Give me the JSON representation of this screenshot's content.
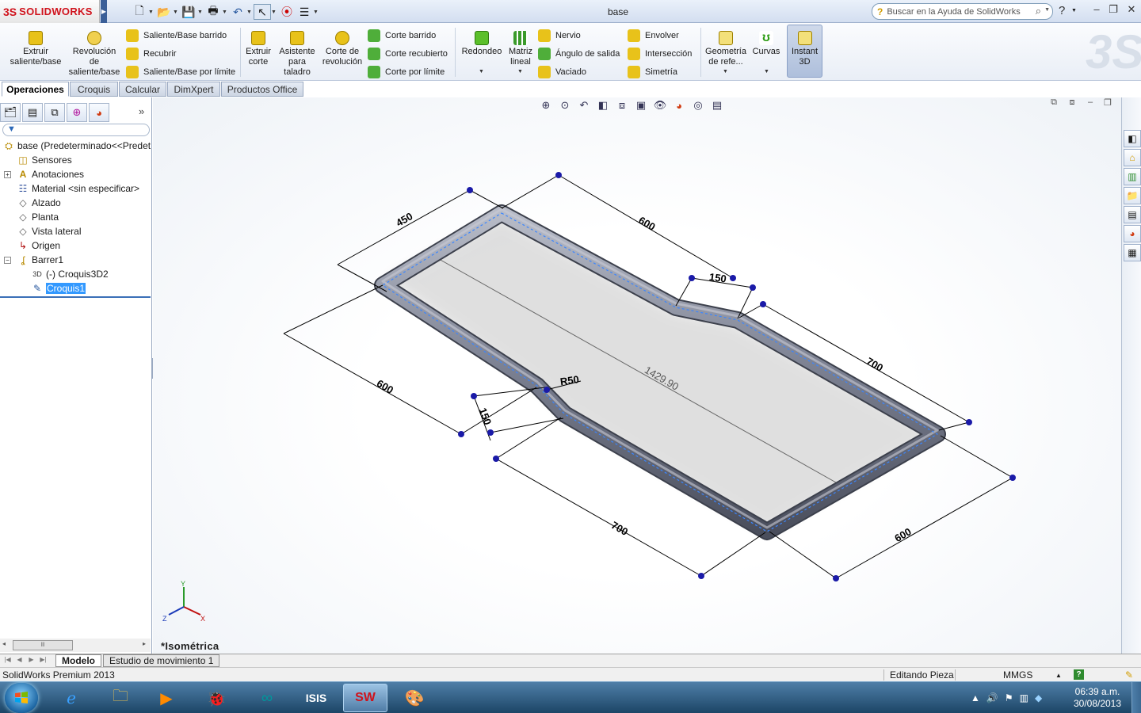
{
  "app": {
    "brand": "SOLIDWORKS",
    "document_title": "base",
    "help_search_placeholder": "Buscar en la Ayuda de SolidWorks"
  },
  "ribbon": {
    "big_buttons": [
      {
        "label": "Extruir saliente/base"
      },
      {
        "label": "Revolución de saliente/base"
      },
      {
        "label": "Extruir corte"
      },
      {
        "label": "Asistente para taladro"
      },
      {
        "label": "Corte de revolución"
      },
      {
        "label": "Redondeo"
      },
      {
        "label": "Matriz lineal"
      },
      {
        "label": "Geometría de refe..."
      },
      {
        "label": "Curvas"
      },
      {
        "label": "Instant 3D"
      }
    ],
    "col1": [
      "Saliente/Base barrido",
      "Recubrir",
      "Saliente/Base por límite"
    ],
    "col2": [
      "Corte barrido",
      "Corte recubierto",
      "Corte por límite"
    ],
    "col3": [
      "Nervio",
      "Ángulo de salida",
      "Vaciado"
    ],
    "col4": [
      "Envolver",
      "Intersección",
      "Simetría"
    ]
  },
  "cm_tabs": [
    "Operaciones",
    "Croquis",
    "Calcular",
    "DimXpert",
    "Productos Office"
  ],
  "feature_tree": {
    "root": "base  (Predeterminado<<Predet",
    "items": [
      "Sensores",
      "Anotaciones",
      "Material <sin especificar>",
      "Alzado",
      "Planta",
      "Vista lateral",
      "Origen",
      "Barrer1"
    ],
    "children": [
      "(-) Croquis3D2",
      "Croquis1"
    ]
  },
  "model": {
    "view_name": "*Isométrica",
    "dims": [
      "450",
      "600",
      "150",
      "700",
      "600",
      "R50",
      "150",
      "700",
      "600",
      "1429.90"
    ],
    "triad": {
      "x": "X",
      "y": "Y",
      "z": "Z"
    }
  },
  "bottom_tabs": [
    "Modelo",
    "Estudio de movimiento 1"
  ],
  "status": {
    "product": "SolidWorks Premium 2013",
    "mode": "Editando Pieza",
    "units": "MMGS",
    "help": "?"
  },
  "clock": {
    "time": "06:39 a.m.",
    "date": "30/08/2013"
  },
  "colors": {
    "brand_red": "#d0121b",
    "tube": "#7a7f90",
    "dim_line": "#000000",
    "handle": "#1a1aa8"
  }
}
